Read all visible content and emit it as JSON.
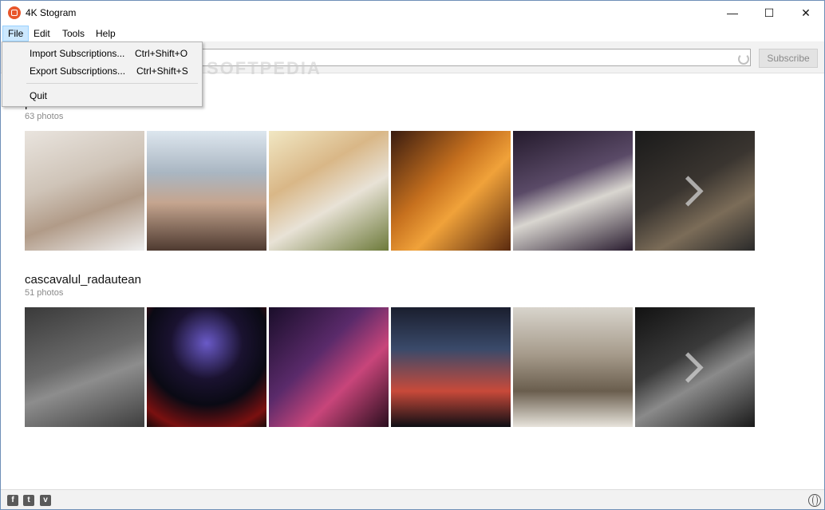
{
  "window": {
    "title": "4K Stogram",
    "minimize": "—",
    "maximize": "☐",
    "close": "✕"
  },
  "menu": {
    "file": "File",
    "edit": "Edit",
    "tools": "Tools",
    "help": "Help"
  },
  "file_menu": {
    "import_label": "Import Subscriptions...",
    "import_shortcut": "Ctrl+Shift+O",
    "export_label": "Export Subscriptions...",
    "export_shortcut": "Ctrl+Shift+S",
    "quit_label": "Quit"
  },
  "toolbar": {
    "search_value": "",
    "subscribe_label": "Subscribe"
  },
  "watermark": "SOFTPEDIA",
  "subscriptions": [
    {
      "name": "pewdie",
      "count": "63 photos"
    },
    {
      "name": "cascavalul_radautean",
      "count": "51 photos"
    }
  ],
  "status_icons": [
    "facebook-icon",
    "twitter-icon",
    "vimeo-icon",
    "globe-icon"
  ],
  "colors": {
    "accent": "#e8562a",
    "menu_highlight": "#cce8ff"
  }
}
